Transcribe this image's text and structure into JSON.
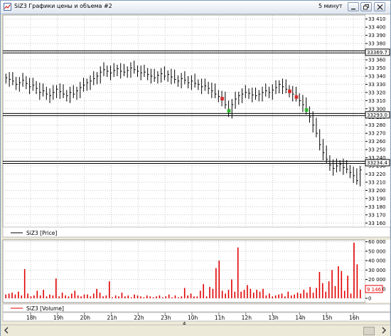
{
  "window": {
    "title": "SiZ3 Графики цены и объема #2",
    "period": "5 минут",
    "scroll_page": "4"
  },
  "price_panel": {
    "legend": "SiZ3 [Price]",
    "y_ticks": [
      "33 410",
      "33 400",
      "33 390",
      "33 380",
      "33 370",
      "33 360",
      "33 350",
      "33 340",
      "33 330",
      "33 320",
      "33 310",
      "33 300",
      "33 290",
      "33 280",
      "33 270",
      "33 260",
      "33 250",
      "33 240",
      "33 230",
      "33 220",
      "33 210",
      "33 200",
      "33 190",
      "33 180",
      "33 170",
      "33 160"
    ],
    "levels": [
      "33369.7",
      "33293.0",
      "33234.4"
    ],
    "level_colors": [
      "#000000",
      "#000000",
      "#000000"
    ],
    "price_color": "#000000",
    "buy_marker_color": "#22c022",
    "sell_marker_color": "#e02020"
  },
  "volume_panel": {
    "legend": "SiZ3 [Volume]",
    "y_ticks": [
      "60 000",
      "50 000",
      "40 000",
      "30 000",
      "20 000",
      "10 000",
      "0"
    ],
    "last_value": "9 146",
    "bar_color": "#e00000"
  },
  "time_axis": [
    "18h",
    "19h",
    "20h",
    "21h",
    "22h",
    "23h",
    "10h",
    "11h",
    "12h",
    "13h",
    "14h",
    "15h",
    "16h"
  ],
  "chart_data": [
    {
      "type": "line",
      "series": [
        {
          "name": "SiZ3 [Price]",
          "values": [
            33338,
            33336,
            33334,
            33330,
            33332,
            33335,
            33331,
            33327,
            33329,
            33325,
            33320,
            33322,
            33318,
            33316,
            33320,
            33324,
            33321,
            33318,
            33316,
            33320,
            33318,
            33322,
            33326,
            33329,
            33332,
            33334,
            33337,
            33340,
            33345,
            33348,
            33346,
            33344,
            33347,
            33349,
            33346,
            33345,
            33347,
            33350,
            33348,
            33346,
            33344,
            33345,
            33342,
            33340,
            33338,
            33341,
            33343,
            33340,
            33342,
            33339,
            33336,
            33334,
            33337,
            33335,
            33332,
            33334,
            33331,
            33330,
            33327,
            33328,
            33325,
            33322,
            33318,
            33315,
            33312,
            33305,
            33297,
            33305,
            33312,
            33316,
            33318,
            33320,
            33319,
            33317,
            33316,
            33318,
            33320,
            33322,
            33320,
            33323,
            33326,
            33330,
            33327,
            33324,
            33321,
            33318,
            33314,
            33310,
            33305,
            33298,
            33290,
            33280,
            33270,
            33256,
            33246,
            33238,
            33231,
            33227,
            33230,
            33232,
            33228,
            33226,
            33222,
            33218,
            33212,
            33225
          ]
        }
      ],
      "ylim": [
        33155,
        33415
      ],
      "levels": [
        33369.7,
        33293.0,
        33234.4
      ]
    },
    {
      "type": "bar",
      "series": [
        {
          "name": "SiZ3 [Volume]",
          "values": [
            4000,
            5000,
            6000,
            4000,
            7000,
            3000,
            31000,
            5000,
            2000,
            3000,
            8000,
            3000,
            9000,
            2000,
            4000,
            3000,
            21000,
            2000,
            6000,
            3000,
            2000,
            5000,
            8000,
            3000,
            2000,
            4000,
            4000,
            2000,
            5000,
            10000,
            6000,
            2000,
            3000,
            18000,
            1000,
            3000,
            2000,
            6000,
            2000,
            3000,
            1000,
            4000,
            3000,
            2000,
            1000,
            3000,
            2000,
            1000,
            2000,
            3000,
            1000,
            2000,
            4000,
            1000,
            3000,
            1000,
            2000,
            11000,
            3000,
            5000,
            2000,
            2000,
            8000,
            15000,
            2000,
            12000,
            10000,
            32000,
            40000,
            8000,
            5000,
            9000,
            20000,
            7000,
            54000,
            7000,
            9000,
            14000,
            10000,
            6000,
            9000,
            7000,
            10000,
            3000,
            5000,
            2000,
            3000,
            4000,
            5000,
            2000,
            7000,
            3000,
            4000,
            6000,
            5000,
            9000,
            6000,
            12000,
            6000,
            11000,
            28000,
            16000,
            7000,
            18000,
            30000,
            13000,
            34000,
            29000,
            8000,
            24000,
            5000,
            59000,
            36000,
            9146
          ]
        }
      ],
      "ylim": [
        0,
        62000
      ]
    }
  ]
}
